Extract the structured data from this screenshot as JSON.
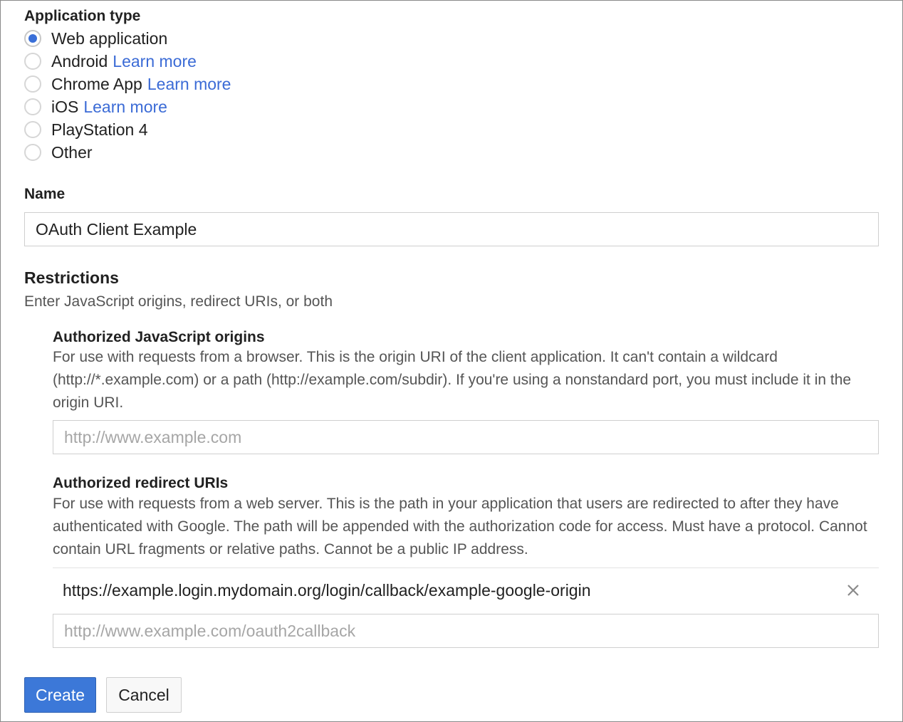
{
  "application_type": {
    "label": "Application type",
    "options": [
      {
        "label": "Web application",
        "link": "",
        "checked": true
      },
      {
        "label": "Android",
        "link": "Learn more",
        "checked": false
      },
      {
        "label": "Chrome App",
        "link": "Learn more",
        "checked": false
      },
      {
        "label": "iOS",
        "link": "Learn more",
        "checked": false
      },
      {
        "label": "PlayStation 4",
        "link": "",
        "checked": false
      },
      {
        "label": "Other",
        "link": "",
        "checked": false
      }
    ]
  },
  "name": {
    "label": "Name",
    "value": "OAuth Client Example"
  },
  "restrictions": {
    "title": "Restrictions",
    "subtitle": "Enter JavaScript origins, redirect URIs, or both",
    "js_origins": {
      "title": "Authorized JavaScript origins",
      "description": "For use with requests from a browser. This is the origin URI of the client application. It can't contain a wildcard (http://*.example.com) or a path (http://example.com/subdir). If you're using a nonstandard port, you must include it in the origin URI.",
      "placeholder": "http://www.example.com",
      "value": ""
    },
    "redirect_uris": {
      "title": "Authorized redirect URIs",
      "description": "For use with requests from a web server. This is the path in your application that users are redirected to after they have authenticated with Google. The path will be appended with the authorization code for access. Must have a protocol. Cannot contain URL fragments or relative paths. Cannot be a public IP address.",
      "entries": [
        "https://example.login.mydomain.org/login/callback/example-google-origin"
      ],
      "placeholder": "http://www.example.com/oauth2callback",
      "value": ""
    }
  },
  "buttons": {
    "create": "Create",
    "cancel": "Cancel"
  },
  "colors": {
    "accent": "#3c78d8",
    "link": "#3b6bd6"
  },
  "icons": {
    "remove": "close-icon",
    "radio": "radio-icon"
  }
}
